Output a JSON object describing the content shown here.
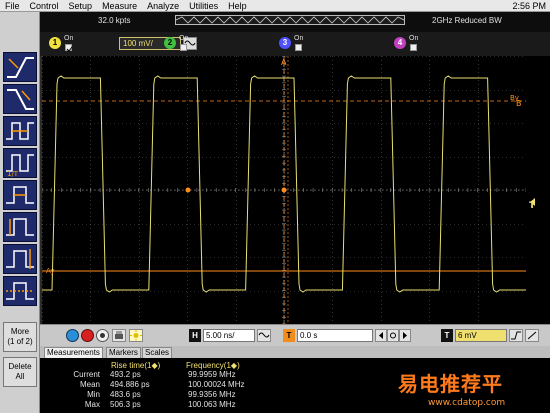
{
  "menu": {
    "items": [
      "File",
      "Control",
      "Setup",
      "Measure",
      "Analyze",
      "Utilities",
      "Help"
    ],
    "clock": "2:56 PM"
  },
  "acquisition": {
    "sample_points": "32.0 kpts",
    "bandwidth": "2GHz Reduced BW"
  },
  "channels": [
    {
      "number": "1",
      "on_label": "On",
      "enabled": true,
      "scale": "100 mV/",
      "color": "#f0e040"
    },
    {
      "number": "2",
      "on_label": "On",
      "enabled": false,
      "color": "#40c040"
    },
    {
      "number": "3",
      "on_label": "On",
      "enabled": false,
      "color": "#5050ff"
    },
    {
      "number": "4",
      "on_label": "On",
      "enabled": false,
      "color": "#c040c0"
    }
  ],
  "sidebar": {
    "more_label": "More",
    "more_page": "(1 of 2)",
    "delete_all_label": "Delete",
    "delete_all_label2": "All"
  },
  "scope_markers": {
    "a_label": "A",
    "b_label": "B",
    "ay_label": "Ay",
    "by_label": "By",
    "trigger_label": "T"
  },
  "controls": {
    "horizontal_label": "H",
    "time_per_div": "5.00 ns/",
    "delay_label": "T",
    "delay_value": "0.0 s",
    "trigger_label": "T",
    "trigger_level": "6 mV"
  },
  "tabs": [
    "Measurements",
    "Markers",
    "Scales"
  ],
  "measurements": {
    "col1_header": "Rise time(1◆)",
    "col2_header": "Frequency(1◆)",
    "rows": [
      {
        "label": "Current",
        "rise": "493.2 ps",
        "freq": "99.9959 MHz"
      },
      {
        "label": "Mean",
        "rise": "494.886 ps",
        "freq": "100.00024 MHz"
      },
      {
        "label": "Min",
        "rise": "483.6 ps",
        "freq": "99.9356 MHz"
      },
      {
        "label": "Max",
        "rise": "506.3 ps",
        "freq": "100.063 MHz"
      }
    ]
  },
  "watermark": {
    "text": "易电推荐平",
    "sub": "www.cdatop.com"
  },
  "colors": {
    "trace": "#e8e070",
    "marker": "#ff8c1a",
    "grid": "#5a5a5a",
    "screen": "#000000"
  }
}
